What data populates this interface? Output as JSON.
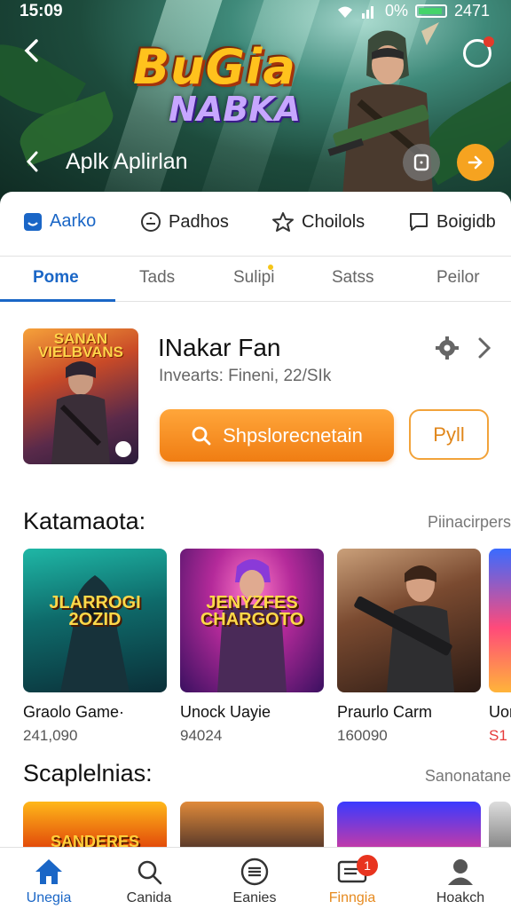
{
  "status_bar": {
    "time": "15:09",
    "battery_text": "0%",
    "right_number": "2471"
  },
  "hero": {
    "logo_line1": "BuGia",
    "logo_line2": "NABKA",
    "title": "Aplk Aplirlan"
  },
  "top_nav": {
    "items": [
      {
        "label": "Aarko",
        "icon": "app-icon"
      },
      {
        "label": "Padhos",
        "icon": "face-icon"
      },
      {
        "label": "Choilols",
        "icon": "star-icon"
      },
      {
        "label": "Boigidb",
        "icon": "chat-icon"
      }
    ]
  },
  "tabs": {
    "items": [
      {
        "label": "Pome"
      },
      {
        "label": "Tads"
      },
      {
        "label": "Sulipi"
      },
      {
        "label": "Satss"
      },
      {
        "label": "Peilor"
      }
    ]
  },
  "featured": {
    "thumb_text": "SANAN VIELBVANS",
    "name": "INakar Fan",
    "subtitle": "Invearts: Fineni, 22/SIk",
    "primary_button": "Shpsloreсnetain",
    "secondary_button": "Pyll"
  },
  "section1": {
    "title": "Katamaota:",
    "link": "Piinacirpers",
    "cards": [
      {
        "img_label": "JLARROGI 2OZID",
        "name": "Graolo Game·",
        "count": "241,090",
        "palette": [
          "#1aa89a",
          "#0c4a50"
        ]
      },
      {
        "img_label": "JENYZFES CHARGOTO",
        "name": "Unock Uayie",
        "count": "94024",
        "palette": [
          "#ff4fa0",
          "#3a1060"
        ]
      },
      {
        "img_label": "",
        "name": "Praurlo Carm",
        "count": "160090",
        "palette": [
          "#b87a4a",
          "#2a1a14"
        ]
      },
      {
        "img_label": "",
        "name": "Uor",
        "count": "S1",
        "palette": [
          "#3a6bff",
          "#ff4a7a"
        ]
      }
    ]
  },
  "section2": {
    "title": "Scaplelnias:",
    "link": "Sanonatane",
    "cards": [
      {
        "img_label": "SANDERES",
        "palette": [
          "#ff9a1a",
          "#b32a0a"
        ]
      },
      {
        "img_label": "",
        "palette": [
          "#5a8a3a",
          "#2a3a1a"
        ]
      },
      {
        "img_label": "",
        "palette": [
          "#3a3aff",
          "#ff3a8a"
        ]
      }
    ]
  },
  "bottom_nav": {
    "items": [
      {
        "label": "Unegia",
        "icon": "home-icon"
      },
      {
        "label": "Canida",
        "icon": "search-icon"
      },
      {
        "label": "Eanies",
        "icon": "list-icon"
      },
      {
        "label": "Finngia",
        "icon": "message-icon",
        "badge": "1"
      },
      {
        "label": "Hoakch",
        "icon": "profile-icon"
      }
    ]
  },
  "colors": {
    "accent_blue": "#1a66c6",
    "accent_orange": "#f07d13",
    "badge_red": "#e8341f"
  }
}
